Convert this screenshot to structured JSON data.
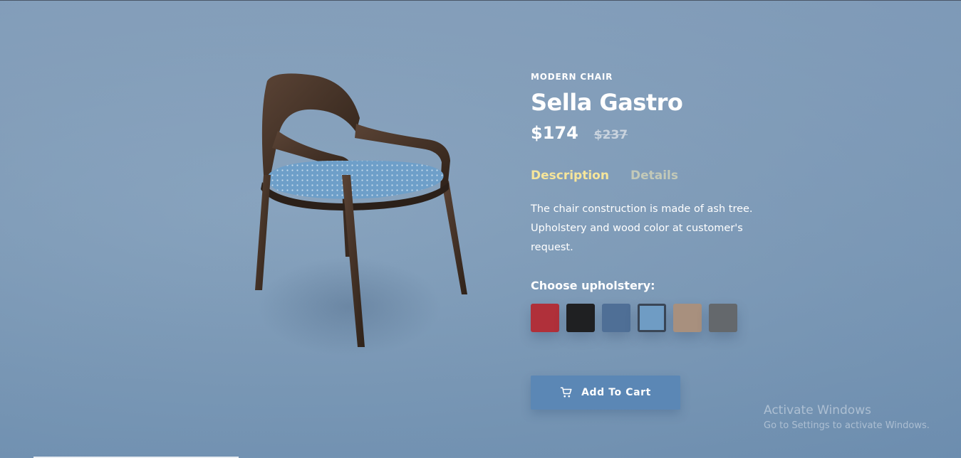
{
  "product": {
    "category": "MODERN CHAIR",
    "name": "Sella Gastro",
    "price_now": "$174",
    "price_old": "$237",
    "image_alt": "chair-image"
  },
  "tabs": [
    {
      "label": "Description",
      "active": true
    },
    {
      "label": "Details",
      "active": false
    }
  ],
  "description": "The chair construction is made of ash tree. Upholstery and wood color at customer's request.",
  "upholstery": {
    "heading": "Choose upholstery:",
    "options": [
      {
        "name": "red",
        "color": "#b0303a",
        "selected": false
      },
      {
        "name": "black",
        "color": "#1f2022",
        "selected": false
      },
      {
        "name": "denim",
        "color": "#4f6f96",
        "selected": false
      },
      {
        "name": "light-blue",
        "color": "#6f9cc4",
        "selected": true
      },
      {
        "name": "beige",
        "color": "#a8907e",
        "selected": false
      },
      {
        "name": "grey",
        "color": "#64686c",
        "selected": false
      }
    ]
  },
  "cart": {
    "label": "Add To Cart",
    "icon": "cart-icon"
  },
  "watermark": {
    "line1": "Activate Windows",
    "line2": "Go to Settings to activate Windows."
  },
  "colors": {
    "accent_tab": "#f6e59a",
    "button": "#5b87b5"
  }
}
